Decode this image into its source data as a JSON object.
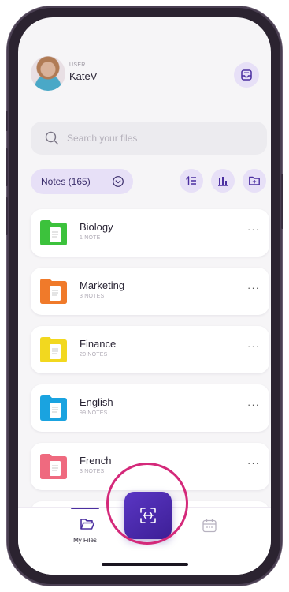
{
  "header": {
    "caption": "USER",
    "username": "KateV"
  },
  "search": {
    "placeholder": "Search your files"
  },
  "filter": {
    "notes_label": "Notes (165)"
  },
  "folders": [
    {
      "name": "Biology",
      "count": "1 NOTE",
      "color": "#3cc23c"
    },
    {
      "name": "Marketing",
      "count": "3 NOTES",
      "color": "#f07a2a"
    },
    {
      "name": "Finance",
      "count": "20 NOTES",
      "color": "#f2d81f"
    },
    {
      "name": "English",
      "count": "99 NOTES",
      "color": "#1aa3e0"
    },
    {
      "name": "French",
      "count": "3 NOTES",
      "color": "#ef6a7f"
    }
  ],
  "more_label": "···",
  "bottom_nav": {
    "files_label": "My Files"
  },
  "colors": {
    "accent": "#4b2fa0",
    "pill_bg": "#e7e0f7",
    "highlight": "#d4297a"
  }
}
